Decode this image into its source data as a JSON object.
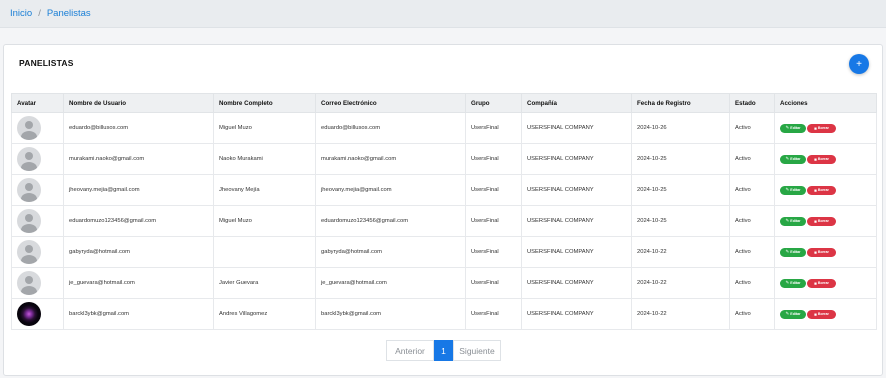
{
  "breadcrumb": {
    "home": "Inicio",
    "separator": "/",
    "current": "Panelistas"
  },
  "card": {
    "title": "PANELISTAS",
    "add_label": "+"
  },
  "table": {
    "headers": [
      "Avatar",
      "Nombre de Usuario",
      "Nombre Completo",
      "Correo Electrónico",
      "Grupo",
      "Compañía",
      "Fecha de Registro",
      "Estado",
      "Acciones"
    ],
    "edit_label": "Editar",
    "delete_label": "Borrar",
    "rows": [
      {
        "avatar": "default",
        "username": "eduardo@billusos.com",
        "full_name": "Miguel Muzo",
        "email": "eduardo@billusos.com",
        "group": "UsersFinal",
        "company": "USERSFINAL COMPANY",
        "date": "2024-10-26",
        "status": "Activo"
      },
      {
        "avatar": "default",
        "username": "murakami.naoko@gmail.com",
        "full_name": "Naoko Murakami",
        "email": "murakami.naoko@gmail.com",
        "group": "UsersFinal",
        "company": "USERSFINAL COMPANY",
        "date": "2024-10-25",
        "status": "Activo"
      },
      {
        "avatar": "default",
        "username": "jheovany.mejia@gmail.com",
        "full_name": "Jheovany Mejía",
        "email": "jheovany.mejia@gmail.com",
        "group": "UsersFinal",
        "company": "USERSFINAL COMPANY",
        "date": "2024-10-25",
        "status": "Activo"
      },
      {
        "avatar": "default",
        "username": "eduardomuzo123456@gmail.com",
        "full_name": "Miguel Muzo",
        "email": "eduardomuzo123456@gmail.com",
        "group": "UsersFinal",
        "company": "USERSFINAL COMPANY",
        "date": "2024-10-25",
        "status": "Activo"
      },
      {
        "avatar": "default",
        "username": "gabyryda@hotmail.com",
        "full_name": "",
        "email": "gabyryda@hotmail.com",
        "group": "UsersFinal",
        "company": "USERSFINAL COMPANY",
        "date": "2024-10-22",
        "status": "Activo"
      },
      {
        "avatar": "default",
        "username": "je_guevara@hotmail.com",
        "full_name": "Javier Guevara",
        "email": "je_guevara@hotmail.com",
        "group": "UsersFinal",
        "company": "USERSFINAL COMPANY",
        "date": "2024-10-22",
        "status": "Activo"
      },
      {
        "avatar": "photo",
        "username": "barckl3ybk@gmail.com",
        "full_name": "Andres Villagomez",
        "email": "barckl3ybk@gmail.com",
        "group": "UsersFinal",
        "company": "USERSFINAL COMPANY",
        "date": "2024-10-22",
        "status": "Activo"
      }
    ]
  },
  "pagination": {
    "prev": "Anterior",
    "current": "1",
    "next": "Siguiente"
  },
  "colors": {
    "primary": "#1778e6",
    "success": "#28a745",
    "danger": "#dc3545",
    "breadcrumb_bg": "#e9ecef"
  }
}
